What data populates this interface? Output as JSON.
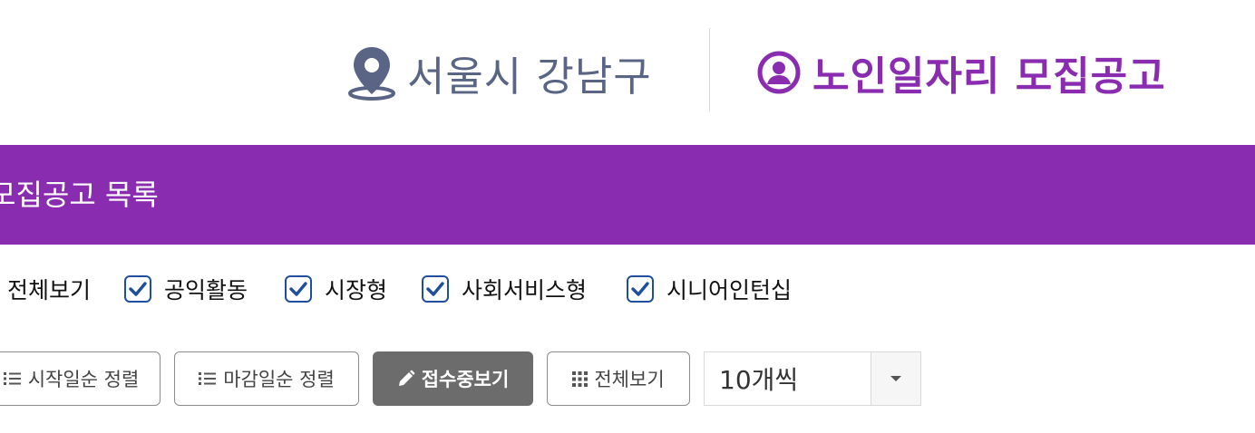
{
  "header": {
    "location": "서울시 강남구",
    "brand_title": "노인일자리 모집공고"
  },
  "list": {
    "title": "모집공고 목록"
  },
  "filters": [
    {
      "label": "전체보기",
      "checked": true
    },
    {
      "label": "공익활동",
      "checked": true
    },
    {
      "label": "시장형",
      "checked": true
    },
    {
      "label": "사회서비스형",
      "checked": true
    },
    {
      "label": "시니어인턴십",
      "checked": true
    }
  ],
  "actions": {
    "sort_start": "시작일순 정렬",
    "sort_deadline": "마감일순 정렬",
    "view_receiving": "접수중보기",
    "view_all": "전체보기"
  },
  "page_size": {
    "selected": "10개씩"
  },
  "colors": {
    "brand_purple": "#8a2cb0",
    "location_gray": "#5a6585",
    "checkbox_blue": "#1f4f9c",
    "active_button": "#6c6c6c"
  },
  "icons": {
    "location": "map-pin-icon",
    "brand": "user-circle-icon",
    "check": "check-icon",
    "list": "list-icon",
    "pencil": "pencil-icon",
    "grid": "grid-icon",
    "caret": "caret-down-icon"
  }
}
